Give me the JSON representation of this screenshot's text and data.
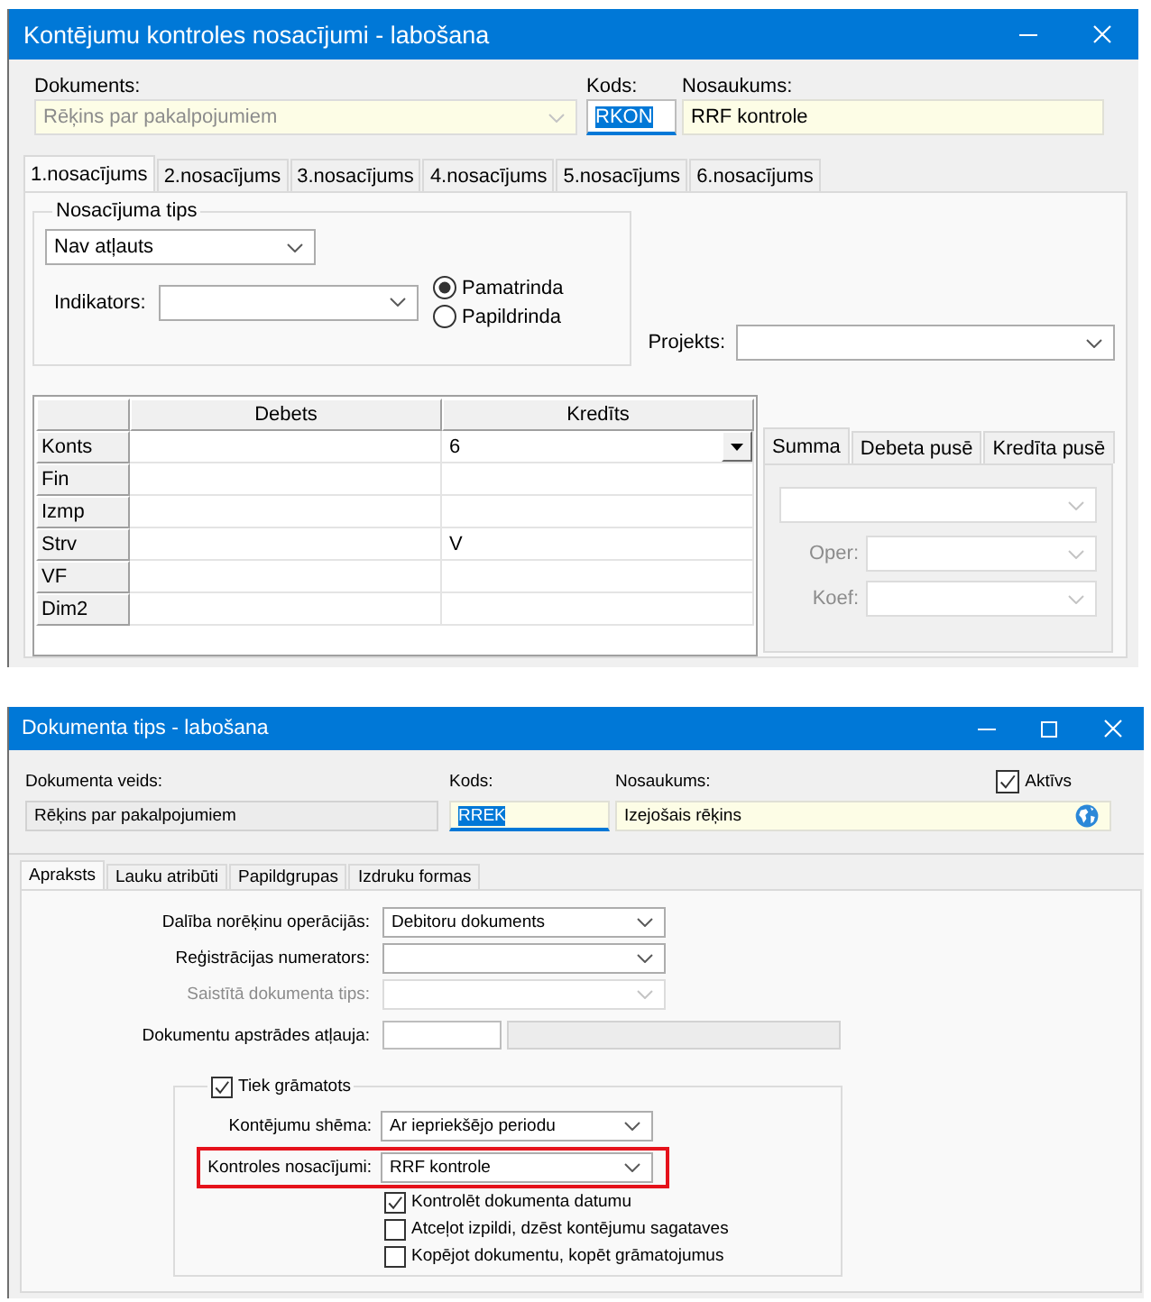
{
  "top_window": {
    "title": "Kontējumu kontroles nosacījumi - labošana",
    "controls": [
      {
        "kind": "minimize"
      },
      {
        "kind": "close"
      }
    ],
    "fields": [
      {
        "kind": "combo",
        "label": "Dokuments:",
        "value": "Rēķins par pakalpojumiem",
        "disabled": true,
        "required": true,
        "focused": false
      },
      {
        "kind": "text",
        "label": "Kods:",
        "value": "RKON",
        "disabled": false,
        "required": false,
        "focused": true
      },
      {
        "kind": "text",
        "label": "Nosaukums:",
        "value": "RRF kontrole",
        "disabled": false,
        "required": true,
        "focused": false
      }
    ],
    "tabs": [
      {
        "label": "1.nosacījums",
        "selected": true
      },
      {
        "label": "2.nosacījums",
        "selected": false
      },
      {
        "label": "3.nosacījums",
        "selected": false
      },
      {
        "label": "4.nosacījums",
        "selected": false
      },
      {
        "label": "5.nosacījums",
        "selected": false
      },
      {
        "label": "6.nosacījums",
        "selected": false
      }
    ],
    "condition_type": {
      "title": "Nosacījuma tips",
      "value": "Nav atļauts"
    },
    "indicator": {
      "label": "Indikators:"
    },
    "row_types": [
      {
        "label": "Pamatrinda",
        "selected": true
      },
      {
        "label": "Papildrinda",
        "selected": false
      }
    ],
    "project": {
      "label": "Projekts:"
    },
    "grid": {
      "columns": [
        "Debets",
        "Kredīts"
      ],
      "rows": [
        {
          "label": "Konts",
          "credit": "6",
          "dropdown": true
        },
        {
          "label": "Fin",
          "dropdown": false
        },
        {
          "label": "Izmp",
          "dropdown": false
        },
        {
          "label": "Strv",
          "credit": "V",
          "dropdown": false
        },
        {
          "label": "VF",
          "dropdown": false
        },
        {
          "label": "Dim2",
          "dropdown": false
        }
      ]
    },
    "amount_tabs": [
      {
        "label": "Summa",
        "selected": true
      },
      {
        "label": "Debeta pusē",
        "selected": false
      },
      {
        "label": "Kredīta pusē",
        "selected": false
      }
    ],
    "amount_panel": {
      "disabled": true,
      "fields": [
        {
          "label": "Oper:"
        },
        {
          "label": "Koef:"
        }
      ]
    }
  },
  "bottom_window": {
    "title": "Dokumenta tips - labošana",
    "controls": [
      {
        "kind": "minimize"
      },
      {
        "kind": "maximize"
      },
      {
        "kind": "close"
      }
    ],
    "fields": [
      {
        "kind": "readonly",
        "label": "Dokumenta veids:",
        "value": "Rēķins par pakalpojumiem",
        "required": false,
        "focused": false
      },
      {
        "kind": "text",
        "label": "Kods:",
        "value": "RREK",
        "required": true,
        "focused": true
      },
      {
        "kind": "translatable",
        "label": "Nosaukums:",
        "value": "Izejošais rēķins",
        "required": true,
        "focused": false
      }
    ],
    "active": {
      "label": "Aktīvs",
      "checked": true
    },
    "tabs": [
      {
        "label": "Apraksts",
        "selected": true
      },
      {
        "label": "Lauku atribūti",
        "selected": false
      },
      {
        "label": "Papildgrupas",
        "selected": false
      },
      {
        "label": "Izdruku formas",
        "selected": false
      }
    ],
    "form_rows": [
      {
        "kind": "combo",
        "label": "Dalība norēķinu operācijās:",
        "value": "Debitoru dokuments",
        "disabled": false
      },
      {
        "kind": "combo",
        "label": "Reģistrācijas numerators:",
        "disabled": false
      },
      {
        "kind": "combo",
        "label": "Saistītā dokumenta tips:",
        "disabled": true
      },
      {
        "kind": "pair",
        "label": "Dokumentu apstrādes atļauja:",
        "disabled": false
      }
    ],
    "posting": {
      "label": "Tiek grāmatots",
      "checked": true,
      "rows": [
        {
          "label": "Kontējumu shēma:",
          "value": "Ar iepriekšējo periodu",
          "highlighted": false
        },
        {
          "label": "Kontroles nosacījumi:",
          "value": "RRF kontrole",
          "highlighted": true
        }
      ],
      "options": [
        {
          "label": "Kontrolēt dokumenta datumu",
          "checked": true
        },
        {
          "label": "Atceļot izpildi, dzēst kontējumu sagataves",
          "checked": false
        },
        {
          "label": "Kopējot dokumentu, kopēt grāmatojumus",
          "checked": false
        }
      ]
    }
  }
}
